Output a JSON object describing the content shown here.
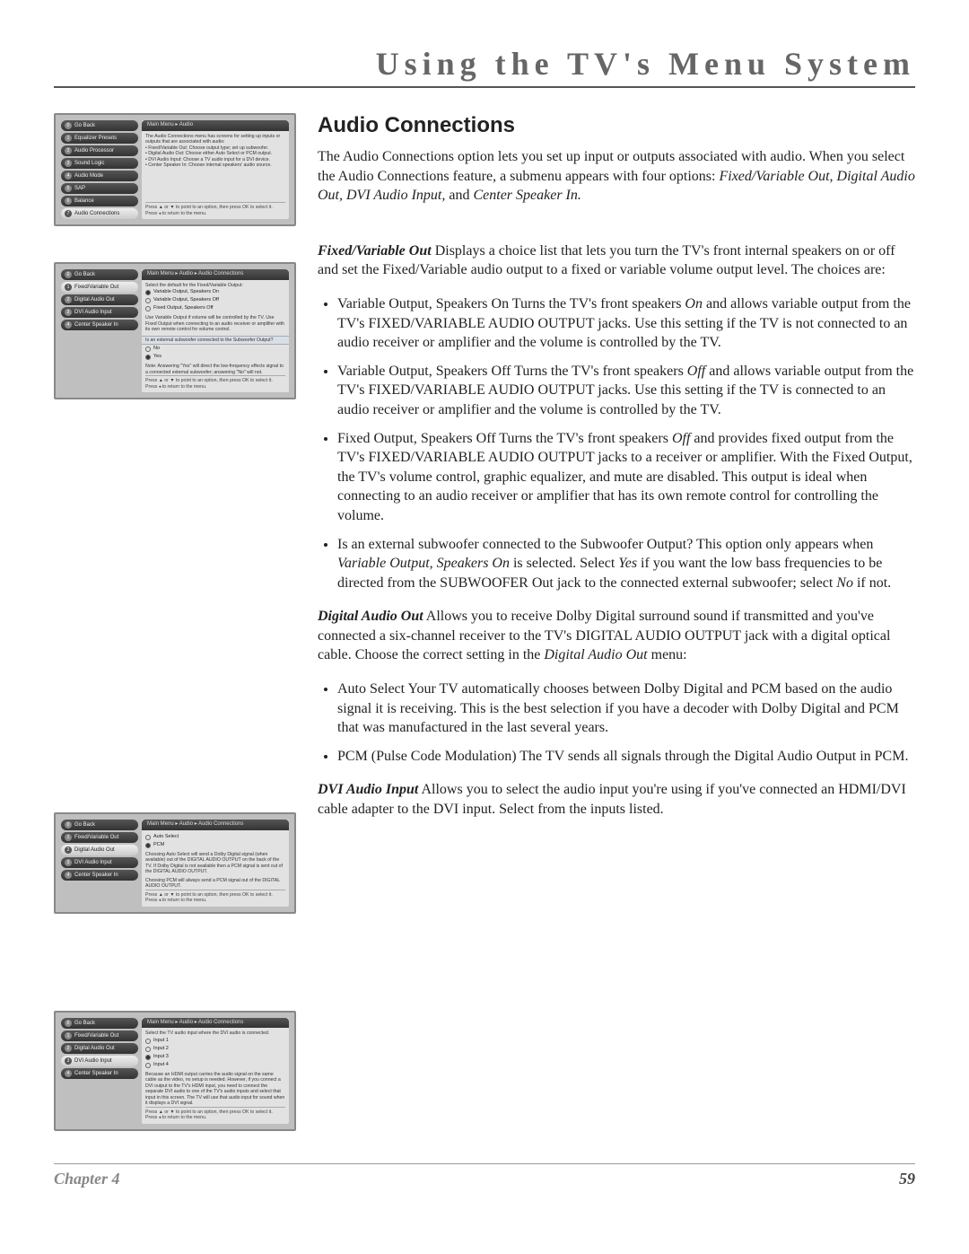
{
  "header": {
    "title": "Using the TV's Menu System"
  },
  "section": {
    "title": "Audio Connections"
  },
  "intro": {
    "p1a": "The Audio Connections option lets you set up input or outputs associated with audio. When you select the Audio Connections feature, a submenu appears with four options: ",
    "p1b_i": "Fixed/Variable Out, Digital Audio Out, DVI Audio Input, ",
    "p1c": "and ",
    "p1d_i": "Center Speaker In."
  },
  "fvo": {
    "head_bi": "Fixed/Variable Out",
    "p1": "    Displays a choice list that lets you turn the TV's front internal speakers on or off and set the Fixed/Variable audio output to a fixed or variable volume output level. The choices are:",
    "li1_head_bi": "Variable Output, Speakers On",
    "li1_mid": "    Turns the TV's front speakers ",
    "li1_i": "On",
    "li1_rest": " and allows variable output from the TV's FIXED/VARIABLE AUDIO OUTPUT jacks. Use this setting if the TV is not connected to an audio receiver or amplifier and the volume is controlled by the TV.",
    "li2_head_bi": "Variable Output, Speakers Off",
    "li2_mid": "    Turns the TV's front speakers ",
    "li2_i": "Off",
    "li2_rest": " and allows variable output from the TV's FIXED/VARIABLE AUDIO OUTPUT jacks. Use this setting if the TV is connected to an audio receiver or amplifier and the volume is controlled by the TV.",
    "li3_head_bi": "Fixed Output, Speakers Off",
    "li3_mid": "    Turns the TV's front speakers ",
    "li3_i": "Off",
    "li3_rest": " and provides fixed output from the TV's FIXED/VARIABLE AUDIO OUTPUT jacks to a receiver or amplifier. With the Fixed Output, the TV's volume control, graphic equalizer, and mute are disabled. This output is ideal when connecting to an audio receiver or amplifier that has its own remote control for controlling the volume.",
    "li4_head_bi": "Is an external subwoofer connected to the Subwoofer Output?",
    "li4_a": " This option only appears when ",
    "li4_b_i": "Variable Output, Speakers On",
    "li4_c": " is selected. Select ",
    "li4_d_i": "Yes",
    "li4_e": " if you want the low bass frequencies to be directed from the SUBWOOFER Out jack to the connected external subwoofer; select ",
    "li4_f_i": "No",
    "li4_g": " if not."
  },
  "dao": {
    "head_bi": "Digital Audio Out",
    "p1": "    Allows you to receive Dolby Digital surround sound if transmitted and you've connected a six-channel receiver to the TV's DIGITAL AUDIO OUTPUT jack with a digital optical cable. Choose the correct setting in the ",
    "p1_i": "Digital Audio Out",
    "p1_end": " menu:",
    "li1_head_bi": "Auto Select",
    "li1_rest": "    Your TV automatically chooses between Dolby Digital and PCM based on the audio signal it is receiving. This is the best selection if you have a decoder with Dolby Digital and PCM that was manufactured in the last several years.",
    "li2_head_bi": "PCM",
    "li2_rest": " (Pulse Code Modulation)    The TV sends all signals through the Digital Audio Output in PCM."
  },
  "dvi": {
    "head_bi": "DVI Audio Input",
    "p1": "    Allows you to select the audio input you're using if you've connected an HDMI/DVI cable adapter to the DVI input. Select from the inputs listed."
  },
  "footer": {
    "chapter": "Chapter 4",
    "page": "59"
  },
  "shot1": {
    "breadcrumb": "Main Menu ▸ Audio",
    "items": [
      "Go Back",
      "Equalizer Presets",
      "Audio Processor",
      "Sound Logic",
      "Audio Mode",
      "SAP",
      "Balance",
      "Audio Connections"
    ],
    "nums": [
      "0",
      "1",
      "2",
      "3",
      "4",
      "5",
      "6",
      "7"
    ],
    "highlight_index": 7,
    "desc_lines": [
      "The Audio Connections menu has screens for setting up inputs or outputs that are associated with audio:",
      "• Fixed/Variable Out: Choose output type; set up subwoofer.",
      "• Digital Audio Out: Choose either Auto Select or PCM output.",
      "• DVI Audio Input: Choose a TV audio input for a DVI device.",
      "• Center Speaker In: Choose internal speakers' audio source."
    ],
    "footer": "Press ▲ or ▼ to point to an option, then press OK to select it. Press ◂ to return to the menu."
  },
  "shot2": {
    "breadcrumb": "Main Menu ▸ Audio ▸ Audio Connections",
    "items": [
      "Go Back",
      "Fixed/Variable Out",
      "Digital Audio Out",
      "DVI Audio Input",
      "Center Speaker In"
    ],
    "nums": [
      "0",
      "1",
      "2",
      "3",
      "4"
    ],
    "highlight_index": 1,
    "heading": "Select the default for the Fixed/Variable Output:",
    "radios": [
      "Variable Output, Speakers On",
      "Variable Output, Speakers Off",
      "Fixed Output, Speakers Off"
    ],
    "radio_selected": 0,
    "note1": "Use Variable Output if volume will be controlled by the TV. Use Fixed Output when connecting to an audio receiver or amplifier with its own remote control for volume control.",
    "q": "Is an external subwoofer connected to the Subwoofer Output?",
    "yn": [
      "No",
      "Yes"
    ],
    "yn_selected": 1,
    "note2": "Note: Answering \"Yes\" will direct the low-frequency effects signal to a connected external subwoofer; answering \"No\" will not.",
    "footer": "Press ▲ or ▼ to point to an option, then press OK to select it. Press ◂ to return to the menu."
  },
  "shot3": {
    "breadcrumb": "Main Menu ▸ Audio ▸ Audio Connections",
    "items": [
      "Go Back",
      "Fixed/Variable Out",
      "Digital Audio Out",
      "DVI Audio Input",
      "Center Speaker In"
    ],
    "nums": [
      "0",
      "1",
      "2",
      "3",
      "4"
    ],
    "highlight_index": 2,
    "radios": [
      "Auto Select",
      "PCM"
    ],
    "radio_selected": 1,
    "note1": "Choosing Auto Select will send a Dolby Digital signal (when available) out of the DIGITAL AUDIO OUTPUT on the back of the TV. If Dolby Digital is not available then a PCM signal is sent out of the DIGITAL AUDIO OUTPUT.",
    "note2": "Choosing PCM will always send a PCM signal out of the DIGITAL AUDIO OUTPUT.",
    "footer": "Press ▲ or ▼ to point to an option, then press OK to select it. Press ◂ to return to the menu."
  },
  "shot4": {
    "breadcrumb": "Main Menu ▸ Audio ▸ Audio Connections",
    "items": [
      "Go Back",
      "Fixed/Variable Out",
      "Digital Audio Out",
      "DVI Audio Input",
      "Center Speaker In"
    ],
    "nums": [
      "0",
      "1",
      "2",
      "3",
      "4"
    ],
    "highlight_index": 3,
    "heading": "Select the TV audio input where the DVI audio is connected.",
    "radios": [
      "Input 1",
      "Input 2",
      "Input 3",
      "Input 4"
    ],
    "radio_selected": 2,
    "note1": "Because an HDMI output carries the audio signal on the same cable as the video, no setup is needed. However, if you connect a DVI output to the TV's HDMI input, you need to connect the separate DVI audio to one of the TV's audio inputs and select that input in this screen. The TV will use that audio input for sound when it displays a DVI signal.",
    "footer": "Press ▲ or ▼ to point to an option, then press OK to select it. Press ◂ to return to the menu."
  }
}
